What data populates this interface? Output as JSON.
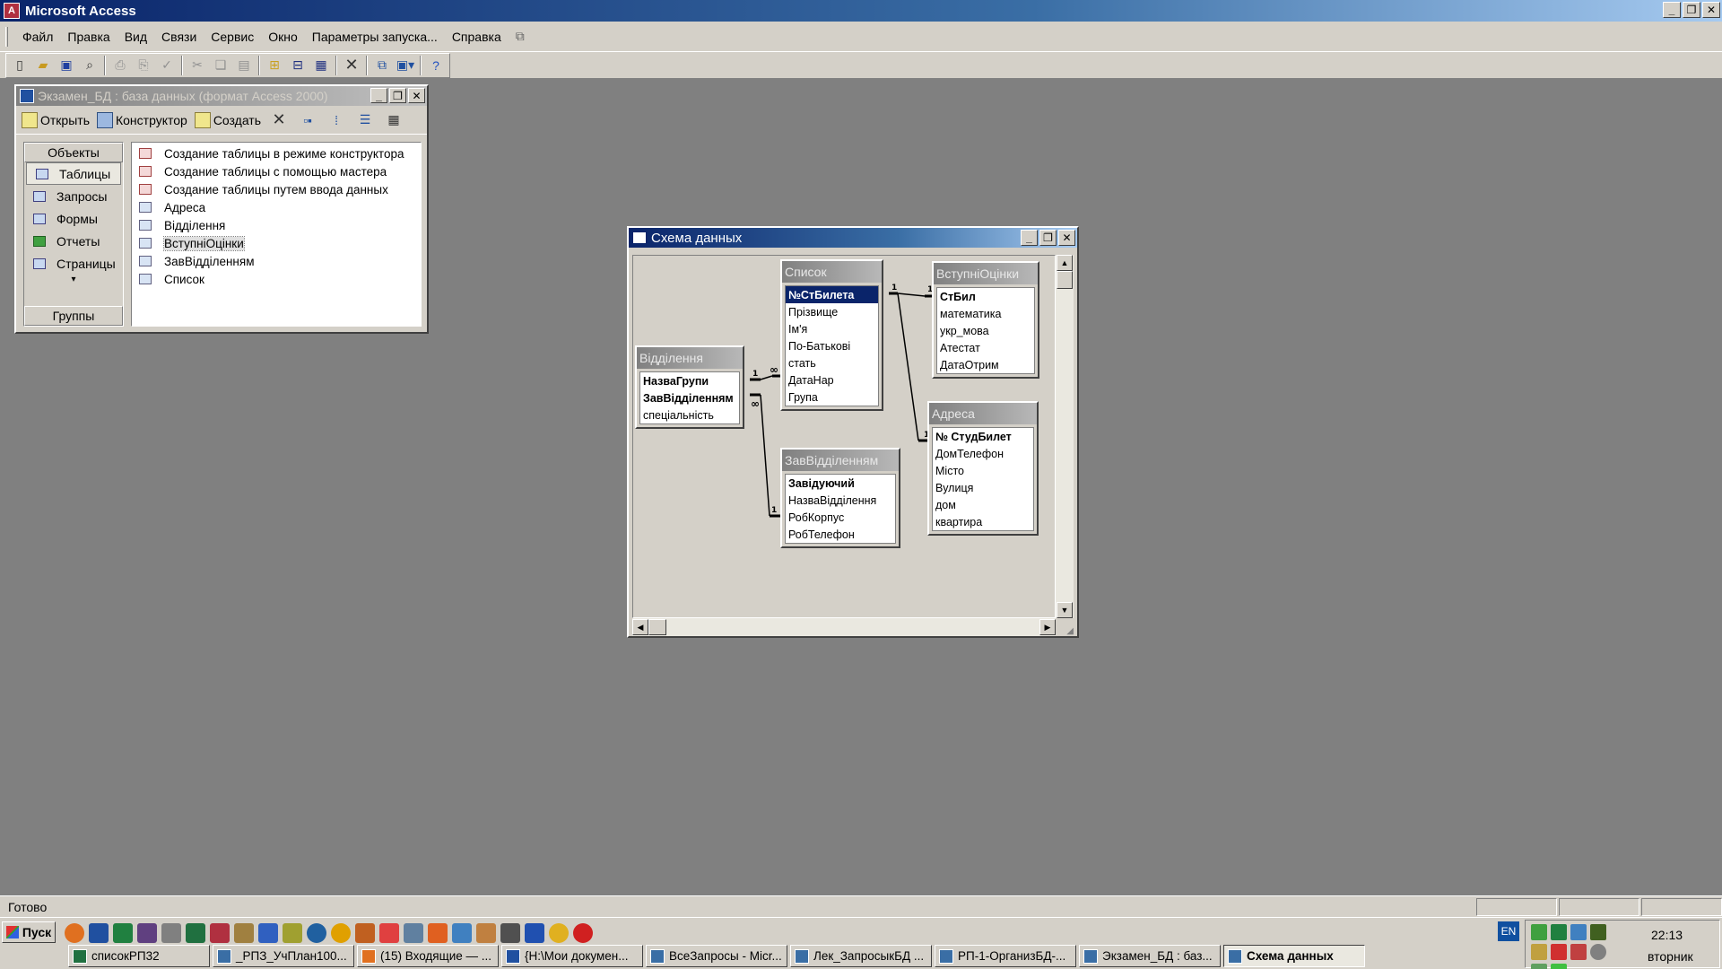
{
  "app": {
    "title": "Microsoft Access",
    "icon": "access-key-icon"
  },
  "window_controls": {
    "minimize": "_",
    "restore": "❐",
    "close": "✕"
  },
  "menu": [
    "Файл",
    "Правка",
    "Вид",
    "Связи",
    "Сервис",
    "Окно",
    "Параметры запуска...",
    "Справка"
  ],
  "toolbar": {
    "icons": [
      "new-icon",
      "open-icon",
      "save-icon",
      "file-search-icon",
      "print-icon",
      "print-preview-icon",
      "spelling-icon",
      "cut-icon",
      "copy-icon",
      "paste-icon",
      "show-table-icon",
      "direct-relationships-icon",
      "all-relationships-icon",
      "delete-icon",
      "database-window-icon",
      "new-object-icon",
      "help-icon"
    ]
  },
  "db_window": {
    "title": "Экзамен_БД : база данных (формат Access 2000)",
    "tools": {
      "open": "Открыть",
      "design": "Конструктор",
      "create": "Создать"
    },
    "objects_header": "Объекты",
    "objects": [
      "Таблицы",
      "Запросы",
      "Формы",
      "Отчеты",
      "Страницы"
    ],
    "more": "▾",
    "groups": "Группы",
    "items": [
      {
        "label": "Создание таблицы в режиме конструктора",
        "kind": "wizard"
      },
      {
        "label": "Создание таблицы с помощью мастера",
        "kind": "wizard"
      },
      {
        "label": "Создание таблицы путем ввода данных",
        "kind": "wizard"
      },
      {
        "label": "Адреса",
        "kind": "table"
      },
      {
        "label": "Відділення",
        "kind": "table"
      },
      {
        "label": "ВступніОцінки",
        "kind": "table",
        "selected": true
      },
      {
        "label": "ЗавВідділенням",
        "kind": "table"
      },
      {
        "label": "Список",
        "kind": "table"
      }
    ]
  },
  "schema_window": {
    "title": "Схема данных",
    "tables": {
      "spisok": {
        "name": "Список",
        "fields": [
          "№СтБилета",
          "Прізвище",
          "Ім'я",
          "По-Батькові",
          "стать",
          "ДатаНар",
          "Група"
        ]
      },
      "vstupni": {
        "name": "ВступніОцінки",
        "fields": [
          "СтБил",
          "математика",
          "укр_мова",
          "Атестат",
          "ДатаОтрим"
        ]
      },
      "viddilennya": {
        "name": "Відділення",
        "fields": [
          "НазваГрупи",
          "ЗавВідділенням",
          "спеціальність"
        ]
      },
      "adresy": {
        "name": "Адреса",
        "fields": [
          "№ СтудБилет",
          "ДомТелефон",
          "Місто",
          "Вулиця",
          "дом",
          "квартира"
        ]
      },
      "zav": {
        "name": "ЗавВідділенням",
        "fields": [
          "Завідуючий",
          "НазваВідділення",
          "РобКорпус",
          "РобТелефон"
        ]
      }
    },
    "relation_labels": {
      "one": "1",
      "many": "∞"
    },
    "scroll": {
      "up": "▲",
      "down": "▼",
      "left": "◀",
      "right": "▶"
    }
  },
  "status": {
    "text": "Готово"
  },
  "taskbar": {
    "start": "Пуск",
    "tasks": [
      "списокРП32",
      "_РПЗ_УчПлан100...",
      "(15) Входящие — ...",
      "{H:\\Мои докумен...",
      "ВсеЗапросы - Micr...",
      "Лек_ЗапросыкБД ...",
      "РП-1-ОрганизБД-...",
      "Экзамен_БД : баз...",
      "Схема данных"
    ],
    "lang": "EN",
    "time": "22:13",
    "day": "вторник"
  },
  "colors": {
    "active_title": "#0a246a",
    "selection": "#0a246a",
    "desktop": "#808080",
    "face": "#d4d0c8"
  }
}
